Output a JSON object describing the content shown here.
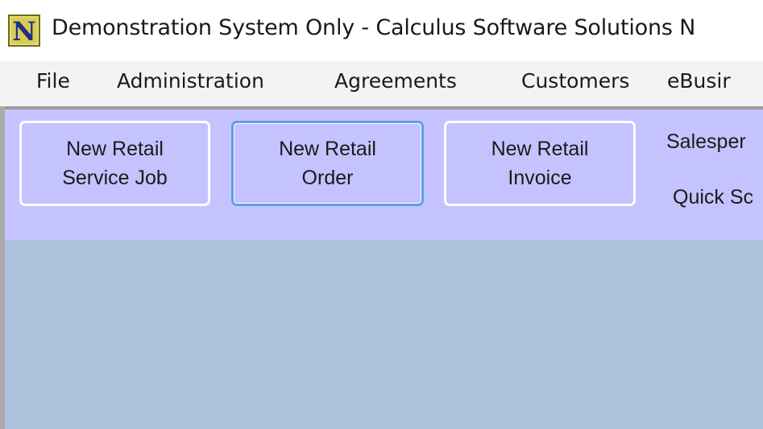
{
  "window": {
    "title": "Demonstration System Only - Calculus Software Solutions N",
    "icon": "application-logo-icon"
  },
  "menu": {
    "items": [
      {
        "label": "File"
      },
      {
        "label": "Administration"
      },
      {
        "label": "Agreements"
      },
      {
        "label": "Customers"
      },
      {
        "label": "eBusir"
      }
    ]
  },
  "toolbar": {
    "buttons": [
      {
        "line1": "New Retail",
        "line2": "Service Job"
      },
      {
        "line1": "New Retail",
        "line2": "Order"
      },
      {
        "line1": "New Retail",
        "line2": "Invoice"
      }
    ],
    "salesperson_label": "Salesper",
    "quick_search_label": "Quick Sc"
  },
  "colors": {
    "toolbar_bg": "#c4c3ff",
    "content_bg": "#adc2dc",
    "focus_border": "#5f9fe0"
  }
}
